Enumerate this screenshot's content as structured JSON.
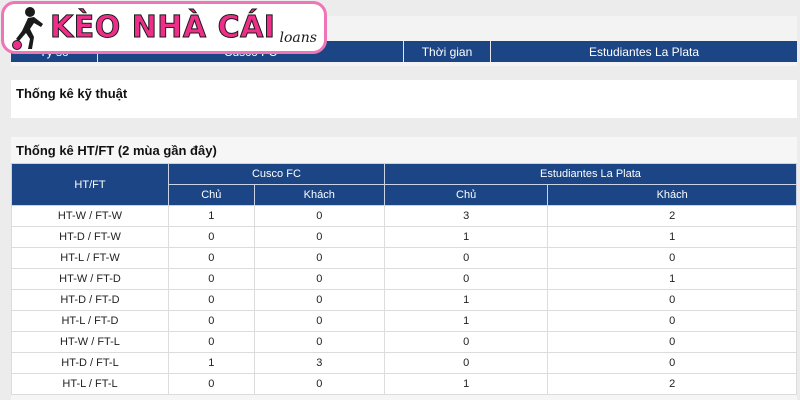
{
  "logo": {
    "main": "KÈO NHÀ CÁI",
    "sub": "loans",
    "icon": "soccer-player-icon"
  },
  "top_table": {
    "headers": [
      "Tỷ số",
      "Cusco FC",
      "Thời gian",
      "Estudiantes La Plata"
    ]
  },
  "section_technical": {
    "title": "Thống kê kỹ thuật"
  },
  "section_htft": {
    "title": "Thống kê HT/FT (2 mùa gần đây)",
    "col_htft": "HT/FT",
    "team1": "Cusco FC",
    "team2": "Estudiantes La Plata",
    "home": "Chủ",
    "away": "Khách",
    "rows": [
      {
        "label": "HT-W / FT-W",
        "v": [
          "1",
          "0",
          "3",
          "2"
        ]
      },
      {
        "label": "HT-D / FT-W",
        "v": [
          "0",
          "0",
          "1",
          "1"
        ]
      },
      {
        "label": "HT-L / FT-W",
        "v": [
          "0",
          "0",
          "0",
          "0"
        ]
      },
      {
        "label": "HT-W / FT-D",
        "v": [
          "0",
          "0",
          "0",
          "1"
        ]
      },
      {
        "label": "HT-D / FT-D",
        "v": [
          "0",
          "0",
          "1",
          "0"
        ]
      },
      {
        "label": "HT-L / FT-D",
        "v": [
          "0",
          "0",
          "1",
          "0"
        ]
      },
      {
        "label": "HT-W / FT-L",
        "v": [
          "0",
          "0",
          "0",
          "0"
        ]
      },
      {
        "label": "HT-D / FT-L",
        "v": [
          "1",
          "3",
          "0",
          "0"
        ]
      },
      {
        "label": "HT-L / FT-L",
        "v": [
          "0",
          "0",
          "1",
          "2"
        ]
      }
    ]
  },
  "colors": {
    "header": "#1b4585",
    "logo_border": "#ef76b6",
    "logo_text": "#ee2f8a"
  }
}
